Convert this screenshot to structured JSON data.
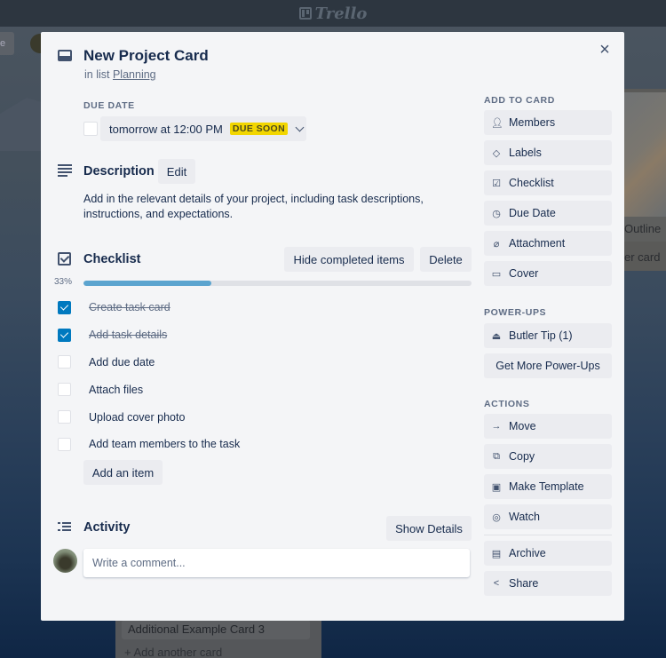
{
  "app": {
    "logo_text": "Trello"
  },
  "background": {
    "top_button_label": "e",
    "right_list": {
      "card_title": "Outline",
      "add_card_label": "er card"
    },
    "bottom_list": {
      "card_title": "Additional Example Card 3",
      "add_card_label": "+ Add another card"
    }
  },
  "card": {
    "title": "New Project Card",
    "list_prefix": "in list",
    "list_name": "Planning",
    "close_label": "×",
    "due_date": {
      "label": "DUE DATE",
      "value": "tomorrow at 12:00 PM",
      "badge": "DUE SOON",
      "badge_color": "#f2d600",
      "completed": false
    },
    "description": {
      "title": "Description",
      "edit_label": "Edit",
      "text": "Add in the relevant details of your project, including task descriptions, instructions, and expectations."
    },
    "checklist": {
      "title": "Checklist",
      "hide_label": "Hide completed items",
      "delete_label": "Delete",
      "progress_label": "33%",
      "progress": 0.33,
      "progress_color": "#5ba4cf",
      "items": [
        {
          "text": "Create task card",
          "checked": true
        },
        {
          "text": "Add task details",
          "checked": true
        },
        {
          "text": "Add due date",
          "checked": false
        },
        {
          "text": "Attach files",
          "checked": false
        },
        {
          "text": "Upload cover photo",
          "checked": false
        },
        {
          "text": "Add team members to the task",
          "checked": false
        }
      ],
      "add_item_label": "Add an item"
    },
    "activity": {
      "title": "Activity",
      "show_details_label": "Show Details",
      "comment_placeholder": "Write a comment..."
    }
  },
  "sidebar": {
    "add_to_card": {
      "label": "ADD TO CARD",
      "items": [
        {
          "label": "Members",
          "icon": "member-icon"
        },
        {
          "label": "Labels",
          "icon": "label-icon"
        },
        {
          "label": "Checklist",
          "icon": "checklist-icon"
        },
        {
          "label": "Due Date",
          "icon": "clock-icon"
        },
        {
          "label": "Attachment",
          "icon": "paperclip-icon"
        },
        {
          "label": "Cover",
          "icon": "cover-icon"
        }
      ]
    },
    "power_ups": {
      "label": "POWER-UPS",
      "items": [
        {
          "label": "Butler Tip (1)",
          "icon": "butler-icon"
        }
      ],
      "get_more_label": "Get More Power-Ups"
    },
    "actions": {
      "label": "ACTIONS",
      "items": [
        {
          "label": "Move",
          "icon": "arrow-right-icon"
        },
        {
          "label": "Copy",
          "icon": "copy-icon"
        },
        {
          "label": "Make Template",
          "icon": "template-icon"
        },
        {
          "label": "Watch",
          "icon": "eye-icon"
        },
        {
          "label": "Archive",
          "icon": "archive-icon"
        },
        {
          "label": "Share",
          "icon": "share-icon"
        }
      ]
    }
  }
}
